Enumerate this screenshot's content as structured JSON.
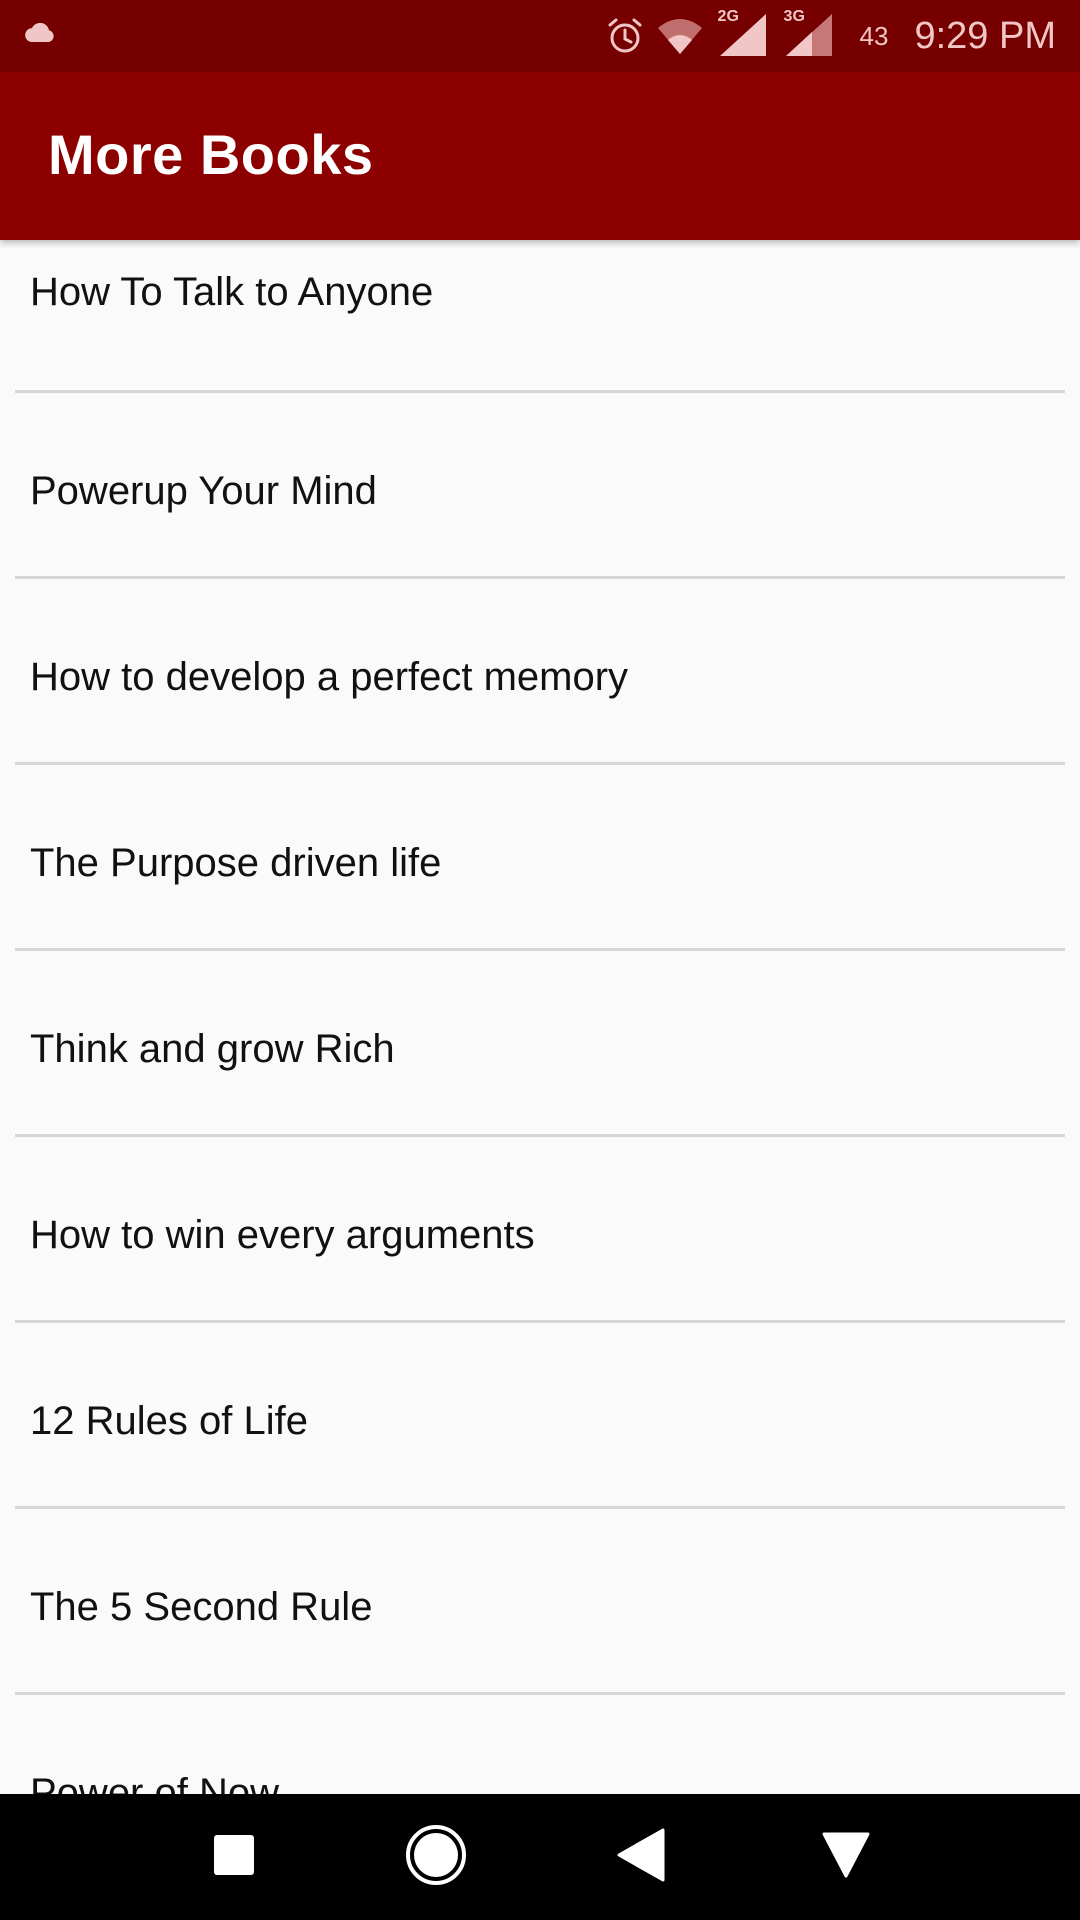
{
  "status_bar": {
    "battery": "43",
    "time": "9:29 PM",
    "network_labels": [
      "2G",
      "3G"
    ],
    "icons": [
      "cloud-icon",
      "alarm-icon",
      "wifi-icon",
      "signal-icon",
      "signal-icon"
    ]
  },
  "app_bar": {
    "title": "More Books"
  },
  "books": [
    "How To Talk to Anyone",
    "Powerup Your Mind",
    "How to develop a perfect memory",
    "The Purpose driven life",
    "Think and grow Rich",
    "How to win every arguments",
    "12 Rules of Life",
    "The 5 Second Rule",
    "Power of Now"
  ],
  "nav_bar": {
    "icons": [
      "recent-apps-icon",
      "home-icon",
      "back-icon",
      "notifications-down-icon"
    ]
  },
  "colors": {
    "status_bar": "#760000",
    "app_bar": "#8d0000",
    "list_background": "#fafafa",
    "divider": "#d6d6d6",
    "nav_bar": "#000000"
  }
}
